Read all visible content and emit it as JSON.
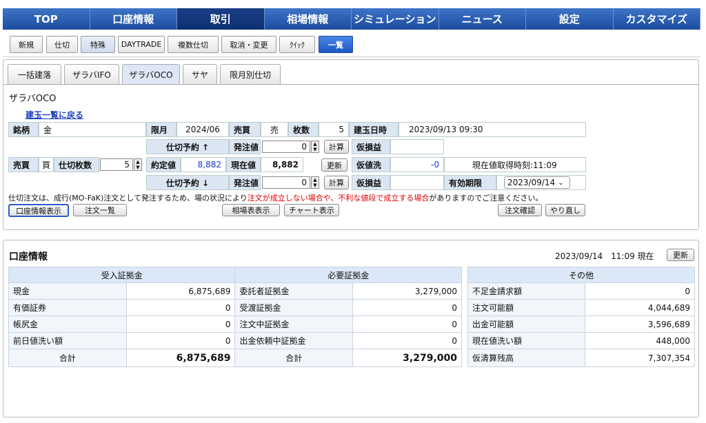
{
  "global_nav": [
    "TOP",
    "口座情報",
    "取引",
    "相場情報",
    "シミュレーション",
    "ニュース",
    "設定",
    "カスタマイズ"
  ],
  "sub_nav": [
    "新規",
    "仕切",
    "特殊",
    "DAYTRADE",
    "複数仕切",
    "取消・変更",
    "ｸｲｯｸ",
    "一覧"
  ],
  "tabs": [
    "一括建落",
    "ザラバIFO",
    "ザラバOCO",
    "サヤ",
    "限月別仕切"
  ],
  "section_title": "ザラバOCO",
  "back_link": "建玉一覧に戻る",
  "position": {
    "brand_label": "銘柄",
    "brand": "金",
    "month_label": "限月",
    "month": "2024/06",
    "side_label": "売買",
    "side": "売",
    "qty_label": "枚数",
    "qty": "5",
    "date_label": "建玉日時",
    "date": "2023/09/13 09:30"
  },
  "upper": {
    "reserve": "仕切予約 ↑",
    "order_label": "発注値",
    "order_value": "0",
    "calc": "計算",
    "pl_label": "仮損益",
    "pl": ""
  },
  "middle": {
    "side_label": "売買",
    "side": "買",
    "qty_label": "仕切枚数",
    "qty": "5",
    "contract_label": "約定値",
    "contract": "8,882",
    "current_label": "現在値",
    "current": "8,882",
    "refresh": "更新",
    "wash_label": "仮値洗",
    "wash": "-0",
    "time_note": "現在値取得時刻:11:09"
  },
  "lower": {
    "reserve": "仕切予約 ↓",
    "order_label": "発注値",
    "order_value": "0",
    "calc": "計算",
    "pl_label": "仮損益",
    "pl": "",
    "expiry_label": "有効期限",
    "expiry": "2023/09/14"
  },
  "notice": {
    "pre": "仕切注文は、成行(MO-FaK)注文として発注するため、場の状況により",
    "red": "注文が成立しない場合や、不利な値段で成立する場合",
    "post": "がありますのでご注意ください。"
  },
  "actions": [
    "口座情報表示",
    "注文一覧",
    "相場表表示",
    "チャート表示",
    "注文確認",
    "やり直し"
  ],
  "account": {
    "title": "口座情報",
    "timestamp": "2023/09/14　11:09 現在",
    "refresh": "更新",
    "headers": [
      "受入証拠金",
      "必要証拠金",
      "その他"
    ],
    "rows": [
      [
        "現金",
        "6,875,689",
        "委託者証拠金",
        "3,279,000",
        "不足金請求額",
        "0"
      ],
      [
        "有価証券",
        "0",
        "受渡証拠金",
        "0",
        "注文可能額",
        "4,044,689"
      ],
      [
        "帳尻金",
        "0",
        "注文中証拠金",
        "0",
        "出金可能額",
        "3,596,689"
      ],
      [
        "前日値洗い額",
        "0",
        "出金依頼中証拠金",
        "0",
        "現在値洗い額",
        "448,000"
      ]
    ],
    "total": [
      "合計",
      "6,875,689",
      "合計",
      "3,279,000",
      "仮清算残高",
      "7,307,354"
    ]
  },
  "colors": {
    "nav": "#1a4fa3",
    "link": "#1a3fbf",
    "red": "#e00000",
    "blue_value": "#1a33cc",
    "label_bg": "#dce6f3"
  }
}
